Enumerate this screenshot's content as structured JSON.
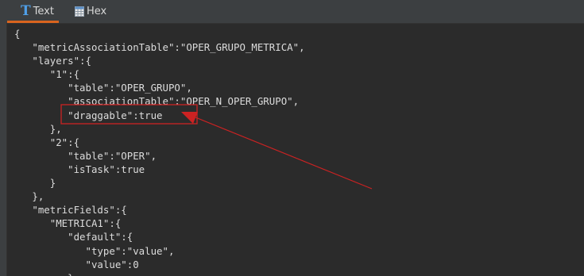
{
  "tabs": {
    "text_label": "Text",
    "hex_label": "Hex"
  },
  "editor": {
    "lines": [
      "{",
      "   \"metricAssociationTable\":\"OPER_GRUPO_METRICA\",",
      "   \"layers\":{",
      "      \"1\":{",
      "         \"table\":\"OPER_GRUPO\",",
      "         \"associationTable\":\"OPER_N_OPER_GRUPO\",",
      "         \"draggable\":true",
      "      },",
      "      \"2\":{",
      "         \"table\":\"OPER\",",
      "         \"isTask\":true",
      "      }",
      "   },",
      "   \"metricFields\":{",
      "      \"METRICA1\":{",
      "         \"default\":{",
      "            \"type\":\"value\",",
      "            \"value\":0",
      "         }"
    ]
  },
  "colors": {
    "tab_accent": "#d9641e",
    "text_icon": "#4f9fe8",
    "annotation": "#cc2222",
    "editor_bg": "#2b2b2b",
    "chrome_bg": "#3c3f41"
  },
  "icons": {
    "text_tab": "text-format-icon",
    "hex_tab": "hex-grid-icon"
  }
}
